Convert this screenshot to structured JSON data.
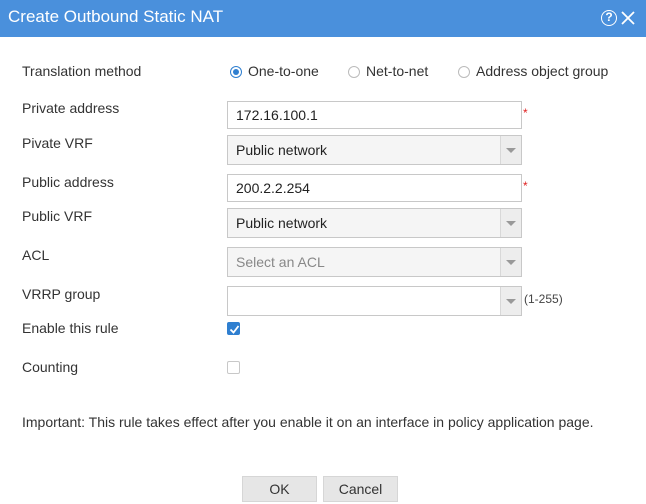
{
  "dialog": {
    "title": "Create Outbound Static NAT",
    "help_icon": "?",
    "icons": [
      "help-icon",
      "close-icon"
    ]
  },
  "form": {
    "translation_method": {
      "label": "Translation method",
      "options": [
        "One-to-one",
        "Net-to-net",
        "Address object group"
      ],
      "selected": "One-to-one"
    },
    "private_address": {
      "label": "Private address",
      "value": "172.16.100.1",
      "required": "*"
    },
    "private_vrf": {
      "label": "Pivate VRF",
      "value": "Public network"
    },
    "public_address": {
      "label": "Public address",
      "value": "200.2.2.254",
      "required": "*"
    },
    "public_vrf": {
      "label": "Public VRF",
      "value": "Public network"
    },
    "acl": {
      "label": "ACL",
      "placeholder": "Select an ACL"
    },
    "vrrp_group": {
      "label": "VRRP group",
      "value": "",
      "hint": "(1-255)"
    },
    "enable_rule": {
      "label": "Enable this rule",
      "checked": true
    },
    "counting": {
      "label": "Counting",
      "checked": false
    }
  },
  "note": "Important: This rule takes effect after you enable it on an interface in policy application page.",
  "buttons": {
    "ok": "OK",
    "cancel": "Cancel"
  },
  "colors": {
    "titlebar": "#4a90dc",
    "accent": "#2f7fd0",
    "required": "#e02020"
  }
}
